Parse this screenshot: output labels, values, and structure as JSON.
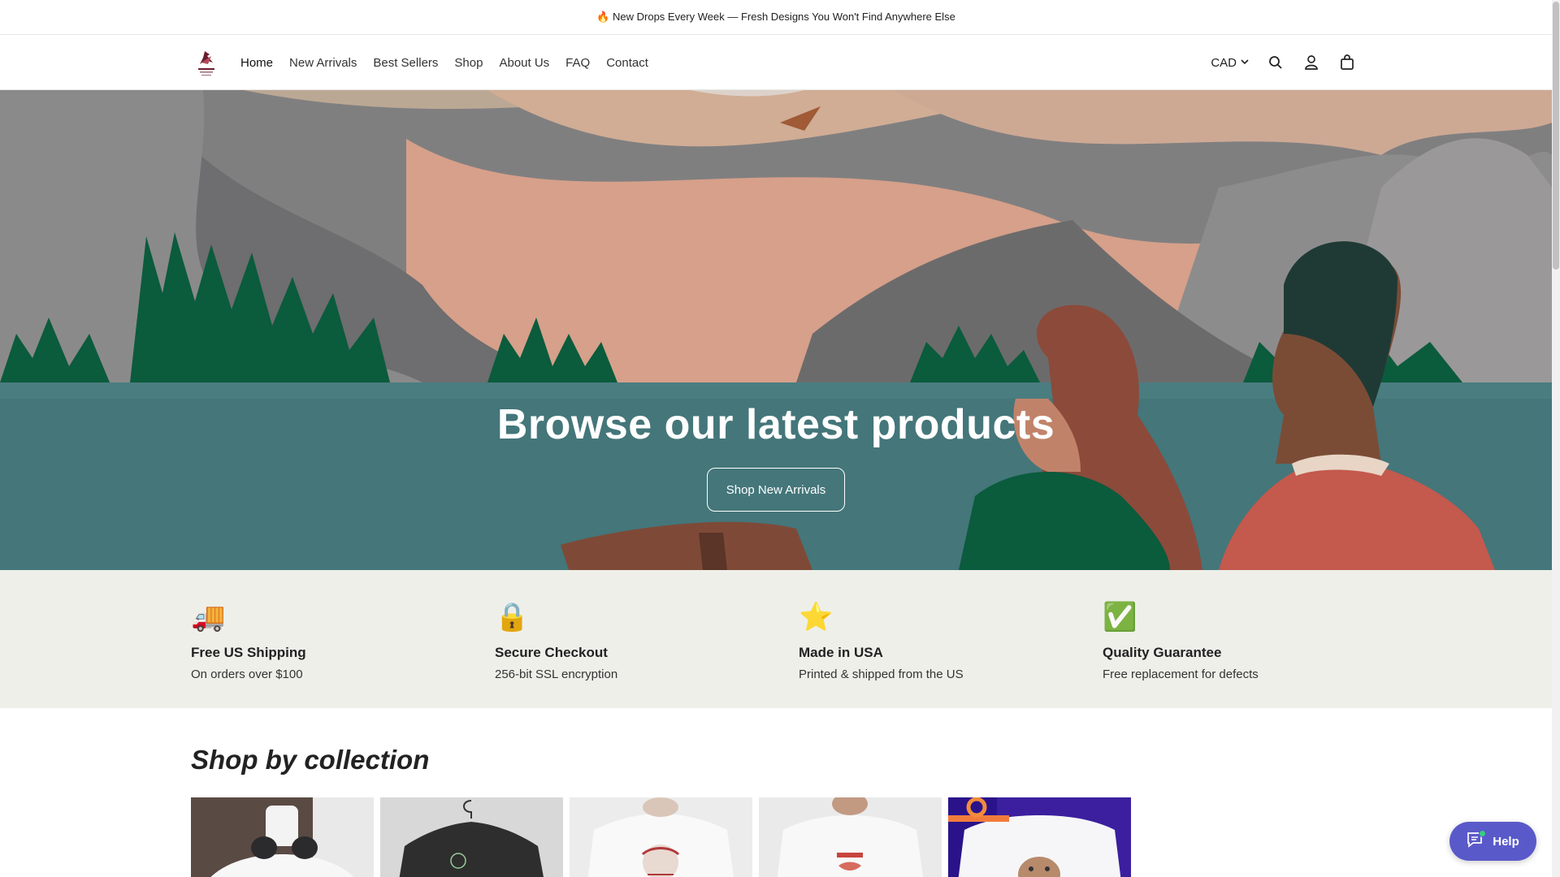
{
  "announcement": {
    "text": "🔥 New Drops Every Week — Fresh Designs You Won't Find Anywhere Else"
  },
  "header": {
    "nav": [
      {
        "label": "Home",
        "active": true
      },
      {
        "label": "New Arrivals"
      },
      {
        "label": "Best Sellers"
      },
      {
        "label": "Shop"
      },
      {
        "label": "About Us"
      },
      {
        "label": "FAQ"
      },
      {
        "label": "Contact"
      }
    ],
    "currency": "CAD",
    "icons": [
      "search-icon",
      "account-icon",
      "cart-icon"
    ]
  },
  "hero": {
    "title": "Browse our latest products",
    "button": "Shop New Arrivals"
  },
  "features": [
    {
      "icon": "🚚",
      "title": "Free US Shipping",
      "desc": "On orders over $100"
    },
    {
      "icon": "🔒",
      "title": "Secure Checkout",
      "desc": "256-bit SSL encryption"
    },
    {
      "icon": "⭐",
      "title": "Made in USA",
      "desc": "Printed & shipped from the US"
    },
    {
      "icon": "✅",
      "title": "Quality Guarantee",
      "desc": "Free replacement for defects"
    }
  ],
  "collections": {
    "title": "Shop by collection",
    "items": [
      {
        "image": "white-tshirt-headphones"
      },
      {
        "image": "black-tshirt-hanger"
      },
      {
        "image": "white-tshirt-holidays"
      },
      {
        "image": "white-tshirt-amour"
      },
      {
        "image": "white-tshirt-kitten"
      }
    ]
  },
  "help": {
    "label": "Help"
  },
  "colors": {
    "accent": "#5a59c9",
    "features_bg": "#eeefe9",
    "hero_water": "#44767a"
  }
}
